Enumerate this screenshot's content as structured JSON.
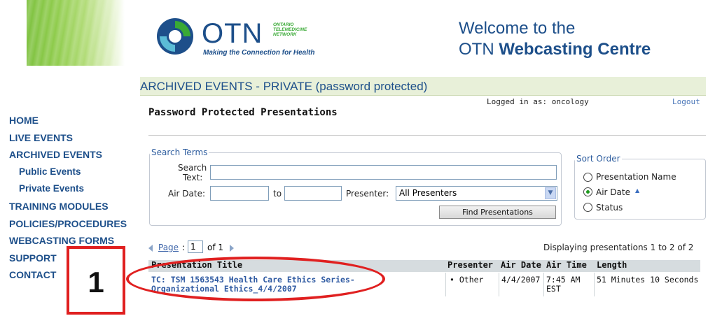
{
  "header": {
    "logo": {
      "word": "OTN",
      "small_text": "ONTARIO TELEMEDICINE NETWORK",
      "tagline": "Making the Connection for Health"
    },
    "welcome_line1": "Welcome to the",
    "welcome_line2_prefix": "OTN",
    "welcome_line2_bold": "Webcasting Centre",
    "accent_color": "#1d4f8a",
    "green_color": "#39a935"
  },
  "nav": {
    "items": [
      {
        "label": "HOME"
      },
      {
        "label": "LIVE EVENTS"
      },
      {
        "label": "ARCHIVED EVENTS"
      },
      {
        "label": "Public Events"
      },
      {
        "label": "Private Events"
      },
      {
        "label": "TRAINING MODULES"
      },
      {
        "label": "POLICIES/PROCEDURES"
      },
      {
        "label": "WEBCASTING FORMS"
      },
      {
        "label": "SUPPORT"
      },
      {
        "label": "CONTACT"
      }
    ]
  },
  "banner": {
    "title": "ARCHIVED EVENTS - PRIVATE (password protected)"
  },
  "session": {
    "logged_in_label": "Logged in as: oncology",
    "logout_label": "Logout"
  },
  "page_title": "Password Protected Presentations",
  "search": {
    "legend": "Search Terms",
    "search_text_label_1": "Search",
    "search_text_label_2": "Text:",
    "search_text_value": "",
    "air_date_label": "Air Date:",
    "air_date_from": "",
    "to_label": "to",
    "air_date_to": "",
    "presenter_label": "Presenter:",
    "presenter_selected": "All Presenters",
    "find_button": "Find Presentations"
  },
  "sort": {
    "legend": "Sort Order",
    "options": [
      {
        "label": "Presentation Name",
        "selected": false
      },
      {
        "label": "Air Date",
        "selected": true
      },
      {
        "label": "Status",
        "selected": false
      }
    ]
  },
  "pager": {
    "page_label": "Page",
    "colon": ":",
    "page_value": "1",
    "of_label": "of 1",
    "displaying": "Displaying presentations 1 to 2 of 2"
  },
  "table": {
    "headers": [
      "Presentation Title",
      "Presenter",
      "Air Date",
      "Air Time",
      "Length"
    ],
    "rows": [
      {
        "title_line1": "TC: TSM 1563543 Health Care Ethics Series-",
        "title_line2": "Organizational Ethics_4/4/2007",
        "presenter": "• Other",
        "air_date": "4/4/2007",
        "air_time_1": "7:45 AM",
        "air_time_2": "EST",
        "length": "51 Minutes 10 Seconds"
      }
    ]
  },
  "annotation": {
    "number": "1",
    "color": "#e02020"
  }
}
